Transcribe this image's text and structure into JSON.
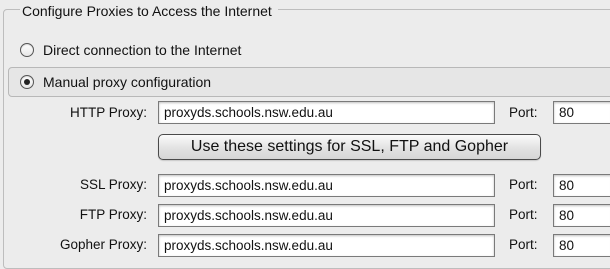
{
  "group_title": "Configure Proxies to Access the Internet",
  "options": {
    "direct": {
      "label": "Direct connection to the Internet",
      "selected": false
    },
    "manual": {
      "label": "Manual proxy configuration",
      "selected": true
    }
  },
  "proxies": {
    "http": {
      "label": "HTTP Proxy:",
      "host": "proxyds.schools.nsw.edu.au",
      "port_label": "Port:",
      "port": "80"
    },
    "ssl": {
      "label": "SSL Proxy:",
      "host": "proxyds.schools.nsw.edu.au",
      "port_label": "Port:",
      "port": "80"
    },
    "ftp": {
      "label": "FTP Proxy:",
      "host": "proxyds.schools.nsw.edu.au",
      "port_label": "Port:",
      "port": "80"
    },
    "gopher": {
      "label": "Gopher Proxy:",
      "host": "proxyds.schools.nsw.edu.au",
      "port_label": "Port:",
      "port": "80"
    }
  },
  "use_settings_button": "Use these settings for SSL, FTP and Gopher"
}
